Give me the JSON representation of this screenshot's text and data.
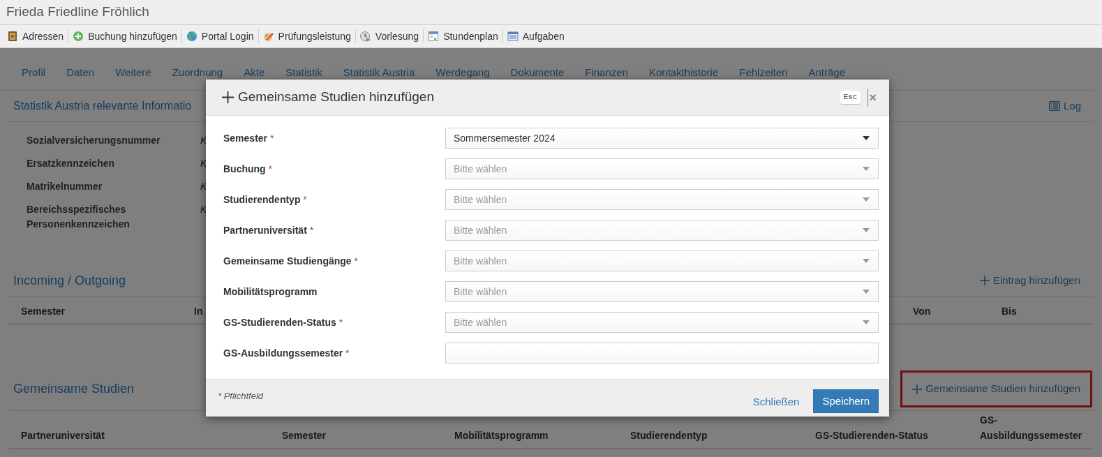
{
  "page_title": "Frieda Friedline Fröhlich",
  "toolbar": [
    {
      "label": "Adressen"
    },
    {
      "label": "Buchung hinzufügen"
    },
    {
      "label": "Portal Login"
    },
    {
      "label": "Prüfungsleistung"
    },
    {
      "label": "Vorlesung"
    },
    {
      "label": "Stundenplan"
    },
    {
      "label": "Aufgaben"
    }
  ],
  "tabs": [
    "Profil",
    "Daten",
    "Weitere",
    "Zuordnung",
    "Akte",
    "Statistik",
    "Statistik Austria",
    "Werdegang",
    "Dokumente",
    "Finanzen",
    "Kontakthistorie",
    "Fehlzeiten",
    "Anträge"
  ],
  "statistik_section": {
    "title": "Statistik Austria relevante Informatio",
    "log_link": "Log",
    "fields": [
      {
        "label": "Sozialversicherungsnummer",
        "value": "K"
      },
      {
        "label": "Ersatzkennzeichen",
        "value": "K"
      },
      {
        "label": "Matrikelnummer",
        "value": "K"
      },
      {
        "label": "Bereichsspezifisches Personenkennzeichen",
        "value": "K"
      }
    ]
  },
  "incoming_section": {
    "title": "Incoming / Outgoing",
    "add_link": {
      "label": "Eintrag hinzufügen",
      "highlighted": false
    },
    "columns": [
      "Semester",
      "In",
      "Von",
      "Bis"
    ]
  },
  "gemeinsame_section": {
    "title": "Gemeinsame Studien",
    "add_link": {
      "label": "Gemeinsame Studien hinzufügen",
      "highlighted": true
    },
    "columns": [
      "Partneruniversität",
      "Semester",
      "Mobilitätsprogramm",
      "Studierendentyp",
      "GS-Studierenden-Status",
      "GS-Ausbildungssemester"
    ]
  },
  "modal": {
    "title": "Gemeinsame Studien hinzufügen",
    "esc_key": "Esc",
    "close": "×",
    "fields": [
      {
        "label": "Semester",
        "required": true,
        "kind": "select",
        "value": "Sommersemester 2024"
      },
      {
        "label": "Buchung",
        "required": true,
        "kind": "select",
        "placeholder": "Bitte wählen"
      },
      {
        "label": "Studierendentyp",
        "required": true,
        "kind": "select",
        "placeholder": "Bitte wählen"
      },
      {
        "label": "Partneruniversität",
        "required": true,
        "kind": "select",
        "placeholder": "Bitte wählen"
      },
      {
        "label": "Gemeinsame Studiengänge",
        "required": true,
        "kind": "select",
        "placeholder": "Bitte wählen"
      },
      {
        "label": "Mobilitätsprogramm",
        "required": false,
        "kind": "select",
        "placeholder": "Bitte wählen"
      },
      {
        "label": "GS-Studierenden-Status",
        "required": true,
        "kind": "select",
        "placeholder": "Bitte wählen"
      },
      {
        "label": "GS-Ausbildungssemester",
        "required": true,
        "kind": "input"
      }
    ],
    "footnote": "Pflichtfeld",
    "required_mark": "*",
    "buttons": {
      "close": "Schließen",
      "save": "Speichern"
    }
  }
}
